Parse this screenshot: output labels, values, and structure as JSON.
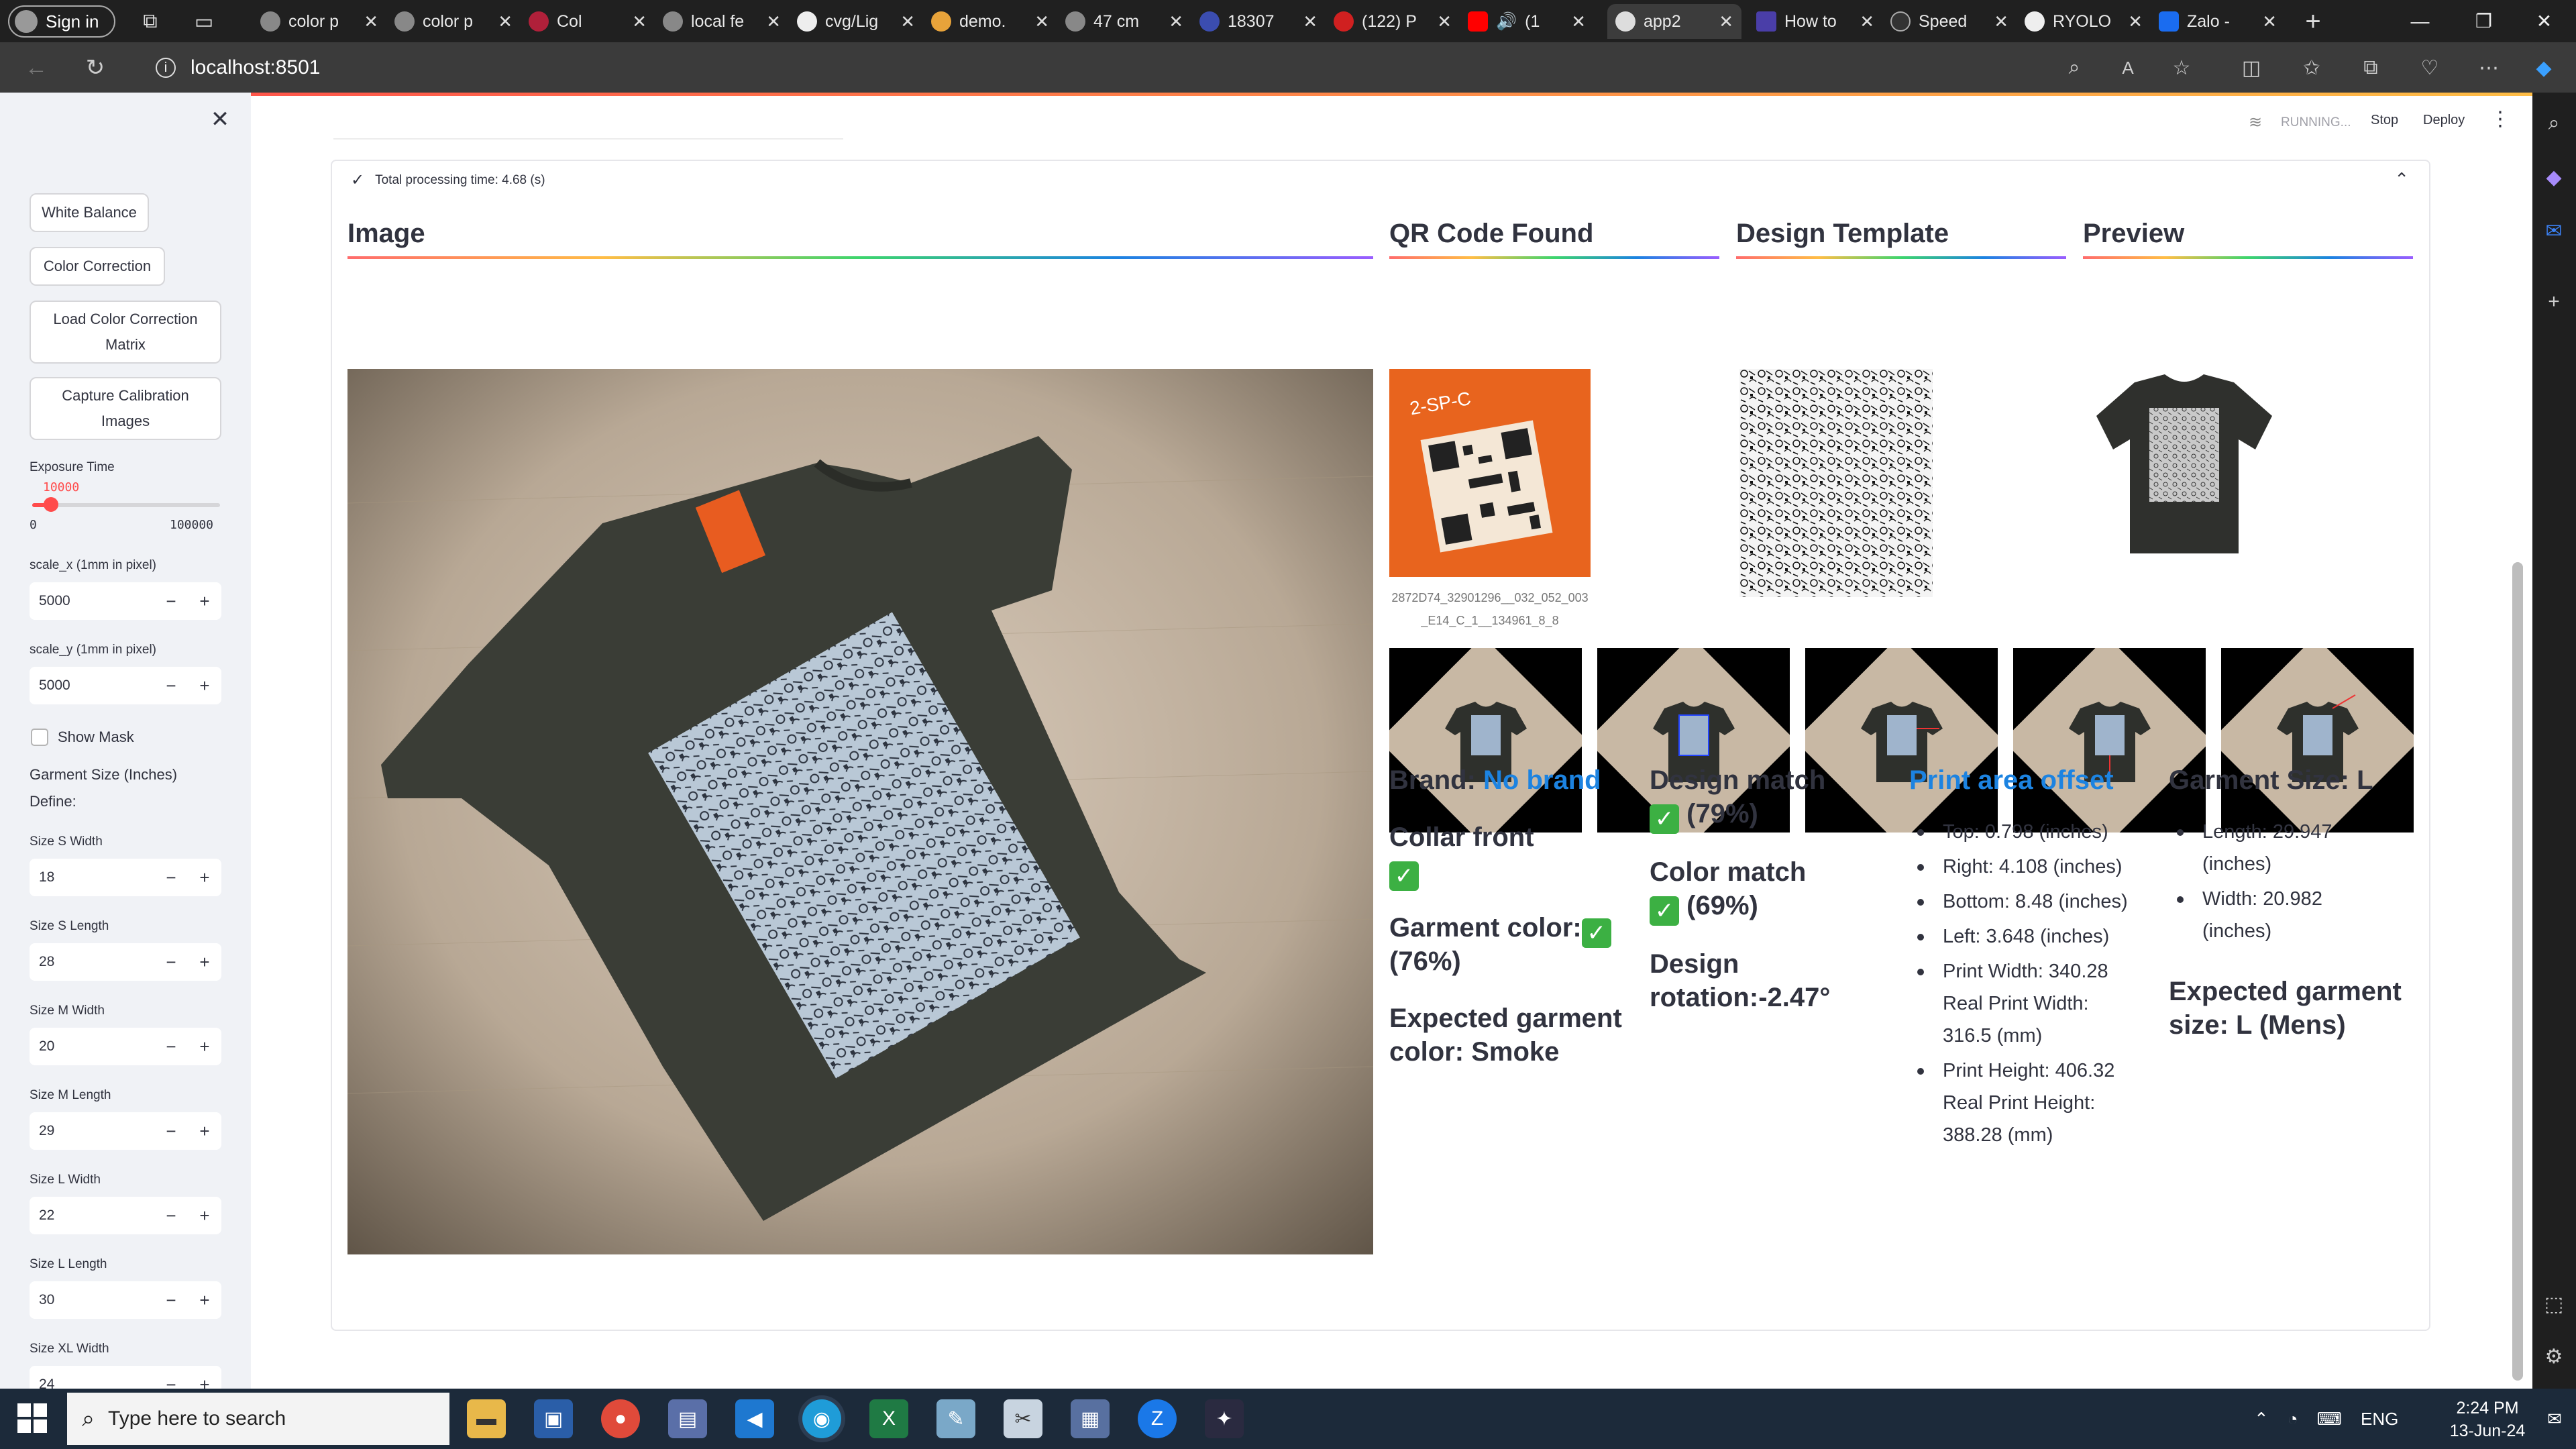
{
  "browser": {
    "signin_label": "Sign in",
    "tabs": [
      {
        "label": "color p"
      },
      {
        "label": "color p"
      },
      {
        "label": "Col"
      },
      {
        "label": "local fe"
      },
      {
        "label": "cvg/Lig"
      },
      {
        "label": "demo."
      },
      {
        "label": "47 cm"
      },
      {
        "label": "18307"
      },
      {
        "label": "(122) P"
      },
      {
        "label": "(1"
      },
      {
        "label": "app2"
      },
      {
        "label": "How to"
      },
      {
        "label": "Speed"
      },
      {
        "label": "RYOLO"
      },
      {
        "label": "Zalo -"
      }
    ],
    "url": "localhost:8501"
  },
  "sidebar": {
    "buttons": {
      "white_balance": "White Balance",
      "color_correction": "Color Correction",
      "load_matrix_l1": "Load Color Correction",
      "load_matrix_l2": "Matrix",
      "capture_l1": "Capture Calibration",
      "capture_l2": "Images"
    },
    "exposure": {
      "label": "Exposure Time",
      "value": "10000",
      "min": "0",
      "max": "100000",
      "fraction": 0.1
    },
    "scale_x": {
      "label": "scale_x (1mm in pixel)",
      "value": "5000"
    },
    "scale_y": {
      "label": "scale_y (1mm in pixel)",
      "value": "5000"
    },
    "show_mask": "Show Mask",
    "garment_size_label": "Garment Size (Inches)",
    "define_label": "Define:",
    "sizes": [
      {
        "label": "Size S Width",
        "value": "18"
      },
      {
        "label": "Size S Length",
        "value": "28"
      },
      {
        "label": "Size M Width",
        "value": "20"
      },
      {
        "label": "Size M Length",
        "value": "29"
      },
      {
        "label": "Size L Width",
        "value": "22"
      },
      {
        "label": "Size L Length",
        "value": "30"
      },
      {
        "label": "Size XL Width",
        "value": "24"
      }
    ]
  },
  "header": {
    "running": "RUNNING...",
    "stop": "Stop",
    "deploy": "Deploy"
  },
  "status": {
    "text": "Total processing time: 4.68 (s)"
  },
  "sections": {
    "image": "Image",
    "qr": "QR Code Found",
    "template": "Design Template",
    "preview": "Preview"
  },
  "qr_caption": "2872D74_32901296__032_052_003_E14_C_1__134961_8_8",
  "results": {
    "brand_label": "Brand:",
    "brand_value": "No brand",
    "collar": "Collar front",
    "garment_color": "Garment color:",
    "garment_color_pct": "(76%)",
    "expected_color_l1": "Expected garment",
    "expected_color_l2": "color: Smoke",
    "design_match": "Design match",
    "design_match_pct": "(79%)",
    "color_match": "Color match",
    "color_match_pct": "(69%)",
    "rotation_l1": "Design",
    "rotation_l2": "rotation:-2.47°",
    "offset_title": "Print area offset",
    "offset_items": [
      "Top: 0.798 (inches)",
      "Right: 4.108 (inches)",
      "Bottom: 8.48 (inches)",
      "Left: 3.648 (inches)",
      "Print Width: 340.28 Real Print Width: 316.5 (mm)",
      "Print Height: 406.32 Real Print Height: 388.28 (mm)"
    ],
    "garment_size": "Garment Size: L",
    "size_items": [
      "Length: 29.947 (inches)",
      "Width: 20.982 (inches)"
    ],
    "expected_size_l1": "Expected garment",
    "expected_size_l2": "size: L (Mens)"
  },
  "taskbar": {
    "search_placeholder": "Type here to search",
    "lang": "ENG",
    "time": "2:24 PM",
    "date": "13-Jun-24"
  },
  "colors": {
    "accent": "#ff4b4b",
    "link": "#1c83e1",
    "check": "#3cb043"
  }
}
